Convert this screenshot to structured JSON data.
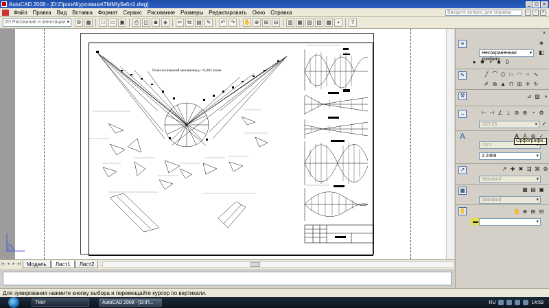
{
  "window": {
    "title": "AutoCAD 2008 - [D:\\Проги\\Курсовики\\ТММ\\у5в6л1.dwg]",
    "controls": [
      "_",
      "□",
      "×"
    ]
  },
  "menu": {
    "items": [
      "Файл",
      "Правка",
      "Вид",
      "Вставка",
      "Формат",
      "Сервис",
      "Рисование",
      "Размеры",
      "Редактировать",
      "Окно",
      "Справка"
    ],
    "help_placeholder": "Введите вопрос для справки"
  },
  "toolbar": {
    "workspace": "2D Рисование и аннотации"
  },
  "drawing": {
    "plot_title": "План положений механизма μ =0,002 м/мм"
  },
  "tabs": {
    "items": [
      "Модель",
      "Лист1",
      "Лист2"
    ],
    "active": "Лист1"
  },
  "status": {
    "hint": "Для зумирования нажмите кнопку выбора и перемещайте курсор по вертикали."
  },
  "palette": {
    "layer_state": "Несохраненная конфигу",
    "dim_style": "ISO-25",
    "text_style": "Гост",
    "text_height": "2.2469",
    "table_style": "Standard",
    "multileader_style": "Standard",
    "tooltip": "Орфографи..."
  },
  "taskbar": {
    "buttons": [
      "ТМИ",
      "AutoCAD 2008 - [D:\\П..."
    ],
    "lang": "RU",
    "clock": "14:59"
  }
}
